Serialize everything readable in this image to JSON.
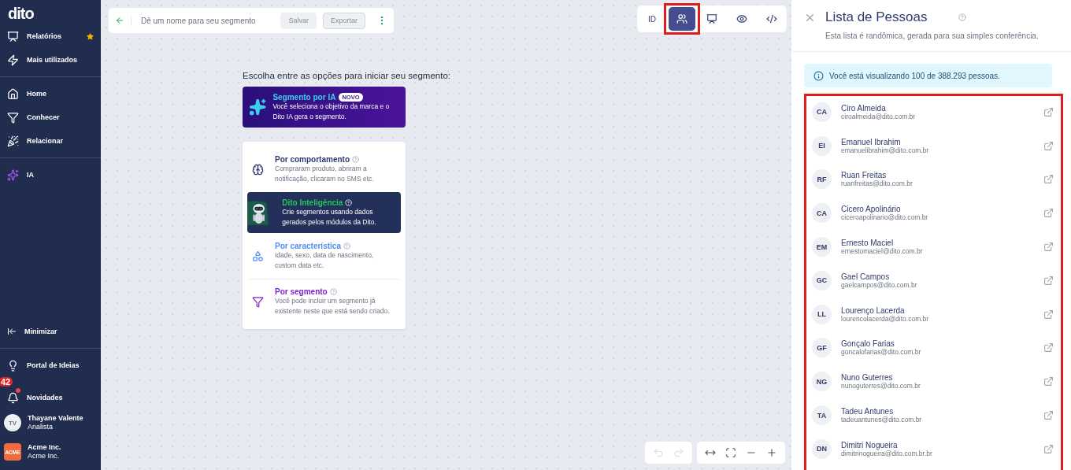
{
  "sidebar": {
    "logo": "dito",
    "groups": [
      {
        "items": [
          {
            "label": "Relatórios",
            "favorite": true
          },
          {
            "label": "Mais utilizados",
            "favorite": false
          }
        ]
      },
      {
        "items": [
          {
            "label": "Home",
            "favorite": false
          },
          {
            "label": "Conhecer",
            "favorite": false
          },
          {
            "label": "Relacionar",
            "favorite": false
          }
        ]
      },
      {
        "items": [
          {
            "label": "IA",
            "favorite": false
          }
        ]
      }
    ],
    "minimize": "Minimizar",
    "bottom_items": [
      {
        "label": "Portal de Ideias",
        "unread": false
      },
      {
        "label": "Novidades",
        "badge": "42",
        "unread": true
      }
    ],
    "user": {
      "initials": "TV",
      "name": "Thayane Valente",
      "role": "Analista"
    },
    "company": {
      "logo": "ACME",
      "name": "Acme Inc.",
      "subtitle": "Acme Inc."
    }
  },
  "header": {
    "placeholder": "Dê um nome para seu segmento",
    "buttons": [
      {
        "label": "Salvar",
        "kind": "filled",
        "disabled": true
      },
      {
        "label": "Exportar",
        "kind": "outline",
        "disabled": true
      }
    ]
  },
  "view_tabs": [
    {
      "kind": "text",
      "label": "ID",
      "selected": false,
      "highlighted": false
    },
    {
      "kind": "people",
      "selected": true,
      "highlighted": true
    },
    {
      "kind": "chart",
      "selected": false,
      "highlighted": false
    },
    {
      "kind": "eye",
      "selected": false,
      "highlighted": false
    },
    {
      "kind": "code",
      "selected": false,
      "highlighted": false
    }
  ],
  "canvas": {
    "prompt": "Escolha entre as opções para iniciar seu segmento:",
    "ai_banner": {
      "title": "Segmento por IA",
      "badge": "NOVO",
      "text": "Você seleciona o objetivo da marca e o Dito IA gera o segmento."
    },
    "options": [
      {
        "kind": "brain",
        "title": "Por comportamento",
        "text": "Compraram produto, abriram a notificação, clicaram no SMS etc.",
        "color": "#2e3a6e"
      },
      {
        "kind": "robot",
        "title": "Dito Inteligência",
        "text": "Crie segmentos usando dados gerados pelos módulos da Dito.",
        "color": "#22c55e"
      },
      {
        "kind": "shapes",
        "title": "Por característica",
        "text": "Idade, sexo, data de nascimento, custom data etc.",
        "color": "#4f8ef7"
      },
      {
        "kind": "funnel",
        "title": "Por segmento",
        "text": "Você pode incluir um segmento já existente neste que está sendo criado.",
        "color": "#7e22ce"
      }
    ]
  },
  "zoom_controls": [
    {
      "kind": "undo",
      "disabled": true
    },
    {
      "kind": "redo",
      "disabled": true
    },
    {
      "kind": "fit",
      "disabled": false
    },
    {
      "kind": "fullscreen",
      "disabled": false
    },
    {
      "kind": "minus",
      "disabled": false
    },
    {
      "kind": "plus",
      "disabled": false
    }
  ],
  "panel": {
    "title": "Lista de Pessoas",
    "subtitle": "Esta lista é randômica, gerada para sua simples conferência.",
    "notice": "Você está visualizando 100 de 388.293 pessoas.",
    "list_highlighted": true,
    "people": [
      {
        "initials": "CA",
        "name": "Ciro Almeida",
        "email": "ciroalmeida@dito.com.br"
      },
      {
        "initials": "EI",
        "name": "Emanuel Ibrahim",
        "email": "emanuelibrahim@dito.com.br"
      },
      {
        "initials": "RF",
        "name": "Ruan Freitas",
        "email": "ruanfreitas@dito.com.br"
      },
      {
        "initials": "CA",
        "name": "Cicero Apolinário",
        "email": "ciceroapolinario@dito.com.br"
      },
      {
        "initials": "EM",
        "name": "Ernesto Maciel",
        "email": "ernestomaciel@dito.com.br"
      },
      {
        "initials": "GC",
        "name": "Gael Campos",
        "email": "gaelcampos@dito.com.br"
      },
      {
        "initials": "LL",
        "name": "Lourenço Lacerda",
        "email": "lourencolacerda@dito.com.br"
      },
      {
        "initials": "GF",
        "name": "Gonçalo Farias",
        "email": "goncalofarias@dito.com.br"
      },
      {
        "initials": "NG",
        "name": "Nuno Guterres",
        "email": "nunoguterres@dito.com.br"
      },
      {
        "initials": "TA",
        "name": "Tadeu Antunes",
        "email": "tadeuantunes@dito.com.br"
      },
      {
        "initials": "DN",
        "name": "Dimitri Nogueira",
        "email": "dimitrinogueira@dito.com.br.br"
      }
    ]
  }
}
